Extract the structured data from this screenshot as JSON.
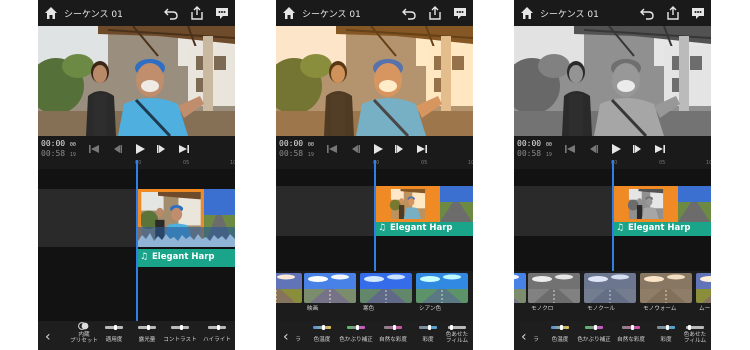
{
  "project_title": "シーケンス 01",
  "timecode_current": "00:00",
  "timecode_current_frames": "00",
  "timecode_total": "00:58",
  "timecode_total_frames": "19",
  "ruler_marks": [
    "00",
    "05",
    "10"
  ],
  "audio_clip_title": "Elegant Harp",
  "colors": {
    "accent": "#2f7fe6",
    "audio": "#1aa58a",
    "clip_border": "#f08a24",
    "bg": "#1a1a1a"
  },
  "icons": [
    "home-icon",
    "undo-icon",
    "share-icon",
    "comment-icon",
    "skip-start-icon",
    "step-back-icon",
    "play-icon",
    "step-forward-icon",
    "skip-end-icon",
    "chevron-left-icon"
  ],
  "screens": [
    {
      "tools": [
        {
          "label": "内蔵\nプリセット"
        },
        {
          "label": "適用度"
        },
        {
          "label": "露光量"
        },
        {
          "label": "コントラスト"
        },
        {
          "label": "ハイライト"
        }
      ]
    },
    {
      "presets": [
        "映画",
        "寒色",
        "シアン色"
      ],
      "tools": [
        {
          "label": "ラ"
        },
        {
          "label": "色温度"
        },
        {
          "label": "色かぶり補正"
        },
        {
          "label": "自然な彩度"
        },
        {
          "label": "彩度"
        },
        {
          "label": "色あせた\nフィルム"
        }
      ]
    },
    {
      "presets": [
        "モノクロ",
        "モノクール",
        "モノウォーム",
        "ムー"
      ],
      "tools": [
        {
          "label": "ラ"
        },
        {
          "label": "色温度"
        },
        {
          "label": "色かぶり補正"
        },
        {
          "label": "自然な彩度"
        },
        {
          "label": "彩度"
        },
        {
          "label": "色あせた\nフィルム"
        }
      ]
    }
  ]
}
